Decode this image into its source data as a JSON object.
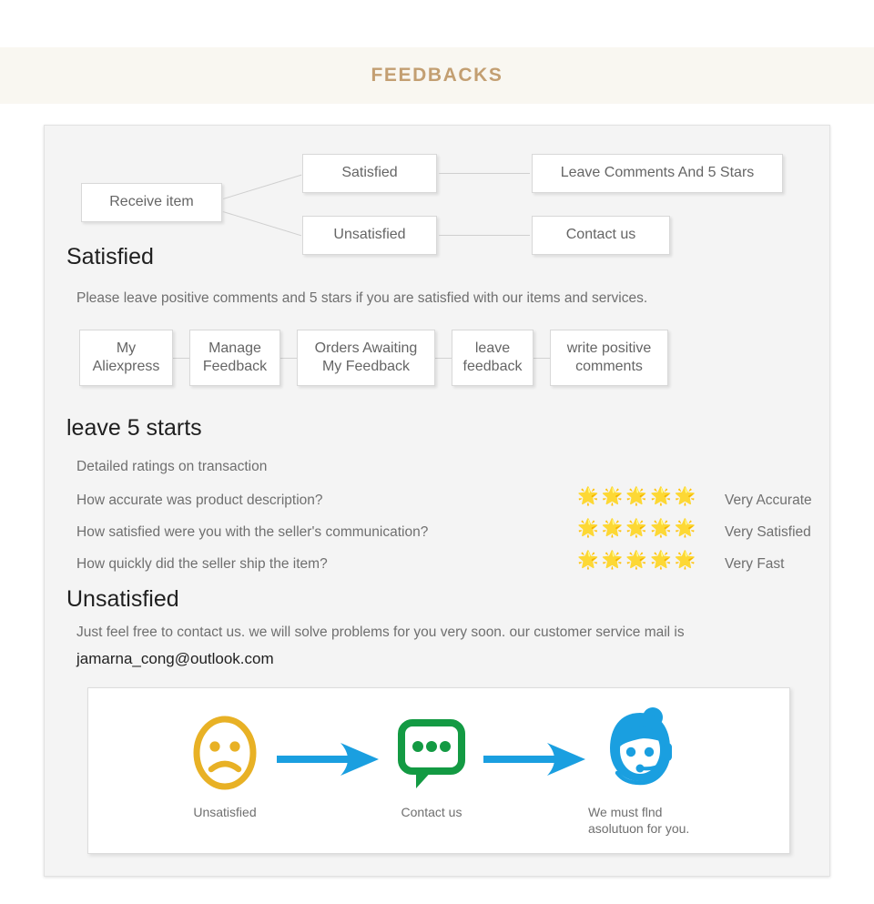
{
  "banner": {
    "title": "FEEDBACKS"
  },
  "colors": {
    "banner_bg": "#f9f7f1",
    "banner_text": "#c39f72",
    "panel_bg": "#f4f4f4",
    "box_border": "#d8d8d8",
    "body_text": "#6f6f6f",
    "heading_text": "#1f1f1f",
    "arrow_blue": "#1a9fe0",
    "bubble_green": "#139a43",
    "face_yellow": "#e8b125",
    "star_gold": "#f5b301"
  },
  "top_flow": {
    "root": "Receive item",
    "branches": [
      {
        "condition": "Satisfied",
        "action": "Leave Comments And 5 Stars"
      },
      {
        "condition": "Unsatisfied",
        "action": "Contact us"
      }
    ]
  },
  "satisfied": {
    "heading": "Satisfied",
    "description": "Please leave positive comments and 5 stars if you are satisfied with our items and services.",
    "steps": [
      "My\nAliexpress",
      "Manage\nFeedback",
      "Orders Awaiting\nMy Feedback",
      "leave\nfeedback",
      "write positive\ncomments"
    ]
  },
  "ratings": {
    "heading": "leave 5 starts",
    "intro": "Detailed ratings on transaction",
    "star_glyph": "🌟",
    "rows": [
      {
        "question": "How accurate was product description?",
        "stars": 5,
        "label": "Very Accurate"
      },
      {
        "question": "How satisfied were you with the seller's communication?",
        "stars": 5,
        "label": "Very Satisfied"
      },
      {
        "question": "How quickly did the seller ship the item?",
        "stars": 5,
        "label": "Very Fast"
      }
    ]
  },
  "unsatisfied": {
    "heading": "Unsatisfied",
    "description": "Just feel free to contact us. we will solve problems for you very soon. our customer service mail is",
    "email": "jamarna_cong@outlook.com"
  },
  "icon_flow": {
    "items": [
      {
        "icon": "sad-face-icon",
        "caption": "Unsatisfied"
      },
      {
        "icon": "speech-bubble-icon",
        "caption": "Contact us"
      },
      {
        "icon": "support-agent-icon",
        "caption": "We must flnd asolutuon for you."
      }
    ],
    "arrow_icon": "arrow-right-icon"
  }
}
